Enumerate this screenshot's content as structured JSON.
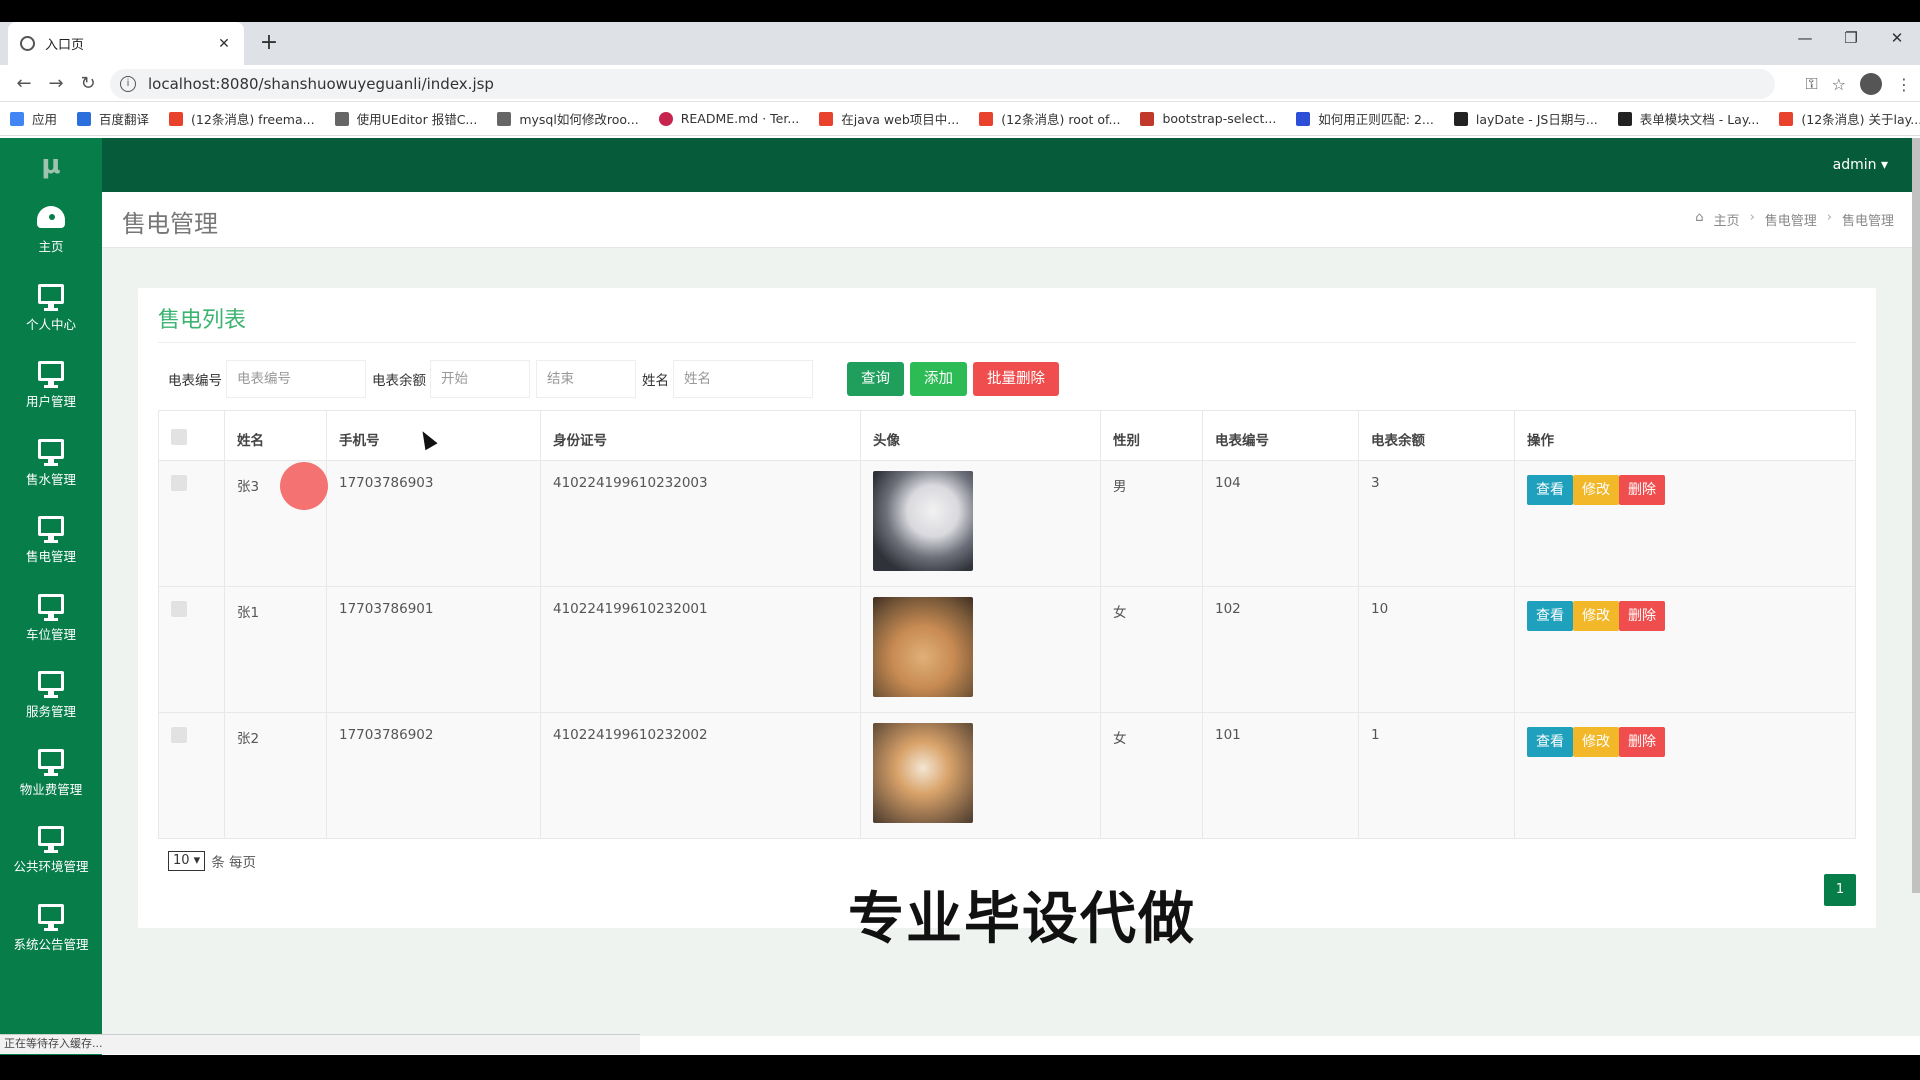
{
  "browser": {
    "tab_title": "入口页",
    "url": "localhost:8080/shanshuowuyeguanli/index.jsp",
    "bookmarks": [
      "应用",
      "百度翻译",
      "(12条消息) freema...",
      "使用UEditor 报错C...",
      "mysql如何修改roo...",
      "README.md · Ter...",
      "在java web项目中...",
      "(12条消息) root of...",
      "bootstrap-select...",
      "如何用正则匹配: 2...",
      "layDate - JS日期与...",
      "表单模块文档 - Lay...",
      "(12条消息) 关于lay..."
    ]
  },
  "header": {
    "user": "admin ▾"
  },
  "sidebar": {
    "items": [
      {
        "label": "主页",
        "icon": "dashboard-icon"
      },
      {
        "label": "个人中心",
        "icon": "monitor-icon"
      },
      {
        "label": "用户管理",
        "icon": "monitor-icon"
      },
      {
        "label": "售水管理",
        "icon": "monitor-icon"
      },
      {
        "label": "售电管理",
        "icon": "monitor-icon"
      },
      {
        "label": "车位管理",
        "icon": "monitor-icon"
      },
      {
        "label": "服务管理",
        "icon": "monitor-icon"
      },
      {
        "label": "物业费管理",
        "icon": "monitor-icon"
      },
      {
        "label": "公共环境管理",
        "icon": "monitor-icon"
      },
      {
        "label": "系统公告管理",
        "icon": "monitor-icon"
      }
    ]
  },
  "page": {
    "title": "售电管理",
    "breadcrumb": [
      "主页",
      "售电管理",
      "售电管理"
    ]
  },
  "panel": {
    "title": "售电列表",
    "search": {
      "meter_label": "电表编号",
      "meter_placeholder": "电表编号",
      "balance_label": "电表余额",
      "start_placeholder": "开始",
      "end_placeholder": "结束",
      "name_label": "姓名",
      "name_placeholder": "姓名",
      "query_btn": "查询",
      "add_btn": "添加",
      "batch_delete_btn": "批量删除"
    },
    "columns": [
      "姓名",
      "手机号",
      "身份证号",
      "头像",
      "性别",
      "电表编号",
      "电表余额",
      "操作"
    ],
    "rows": [
      {
        "name": "张3",
        "phone": "17703786903",
        "id": "410224199610232003",
        "avatar": "husky",
        "gender": "男",
        "meter": "104",
        "balance": "3"
      },
      {
        "name": "张1",
        "phone": "17703786901",
        "id": "410224199610232001",
        "avatar": "cat",
        "gender": "女",
        "meter": "102",
        "balance": "10"
      },
      {
        "name": "张2",
        "phone": "17703786902",
        "id": "410224199610232002",
        "avatar": "shiba",
        "gender": "女",
        "meter": "101",
        "balance": "1"
      }
    ],
    "actions": {
      "view": "查看",
      "edit": "修改",
      "delete": "删除"
    },
    "page_size": "10",
    "per_page_text": "条 每页",
    "current_page": "1"
  },
  "overlay": {
    "watermark": "专业毕设代做",
    "status": "正在等待存入缓存..."
  }
}
